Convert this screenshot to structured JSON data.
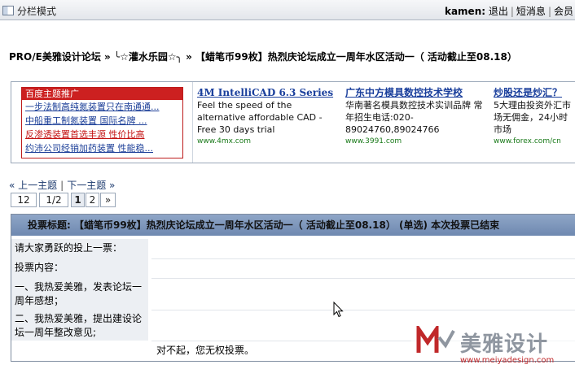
{
  "topbar": {
    "mode_label": "分栏模式",
    "username": "kamen:",
    "links": [
      "退出",
      "短消息",
      "会员"
    ]
  },
  "breadcrumb": "PRO/E美雅设计论坛 » ╰☆灌水乐园☆╮ » 【蜡笔币99枚】热烈庆论坛成立一周年水区活动一（ 活动截止至08.18）",
  "text_ad": {
    "header": "百度主题推广",
    "lines": [
      "一步法制高纯氮装置只在南通通...",
      "中船重工制氮装置 国际名牌 ...",
      "反渗透装置首选丰源 性价比高",
      "约沛公司经销加药装置 性能稳..."
    ]
  },
  "ads": [
    {
      "title": "4M IntelliCAD 6.3 Series",
      "desc": "Feel the speed of the alternative affordable CAD - Free 30 days trial",
      "url": "www.4mx.com"
    },
    {
      "title": "广东中方模具数控技术学校",
      "desc": "华南著名模具数控技术实训品牌 常年招生电话:020-89024760,89024766",
      "url": "www.3991.com"
    },
    {
      "title": "炒股还是炒汇？",
      "desc": "5大理由投资外汇市场无佣金，24小时市场",
      "url": "www.forex.com/cn"
    }
  ],
  "nav": {
    "prev": "« 上一主题",
    "next": "下一主题 »"
  },
  "pager": {
    "items": [
      "12",
      "1/2",
      "1",
      "2",
      "»"
    ],
    "current": "1"
  },
  "poll": {
    "title": "投票标题: 【蜡笔币99枚】热烈庆论坛成立一周年水区活动一（ 活动截止至08.18） (单选) 本次投票已结束",
    "rows": [
      "请大家勇跃的投上一票：",
      "投票内容：",
      "一、我热爱美雅，发表论坛一周年感想；",
      "二、我热爱美雅，提出建设论坛一周年整改意见;"
    ],
    "footer": "对不起，您无权投票。"
  },
  "watermark": {
    "name": "美雅设计",
    "url": "www.meiyadesign.com"
  },
  "colors": {
    "header_bar": "#7a92b8",
    "ad_red": "#cc2020",
    "link_blue": "#1a3f9c"
  }
}
